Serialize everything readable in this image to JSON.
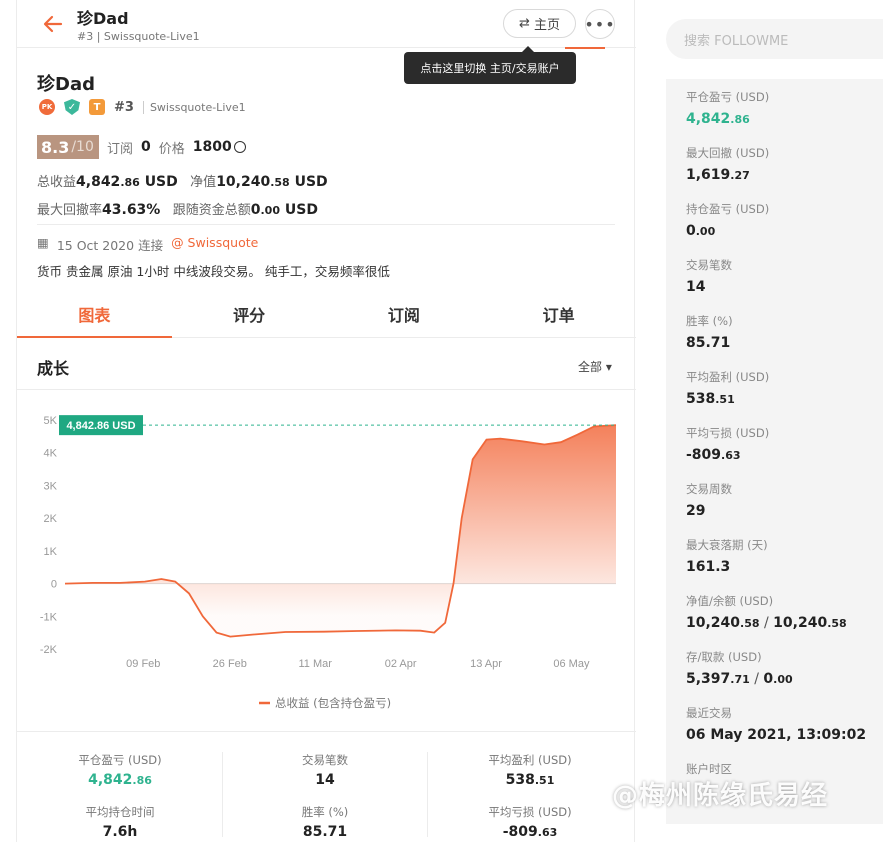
{
  "header": {
    "name": "珍Dad",
    "rank": "#3",
    "broker": "Swissquote-Live1",
    "home_label": "主页",
    "more_label": "•••",
    "tooltip": "点击这里切换 主页/交易账户"
  },
  "profile": {
    "name": "珍Dad",
    "badge_pk": "PK",
    "badge_t": "T",
    "rank": "#3",
    "broker": "Swissquote-Live1",
    "score": "8.3",
    "score_max": "/10",
    "subs_label": "订阅",
    "subs_value": "0",
    "price_label": "价格",
    "price_value": "1800",
    "total_label": "总收益",
    "total_int": "4,842",
    "total_dec": ".86",
    "total_unit": "USD",
    "equity_label": "净值",
    "equity_int": "10,240",
    "equity_dec": ".58",
    "equity_unit": "USD",
    "dd_label": "最大回撤率",
    "dd_value": "43.63%",
    "follow_label": "跟随资金总额",
    "follow_int": "0",
    "follow_dec": ".00",
    "follow_unit": "USD",
    "date": "15 Oct 2020 连接",
    "ext": "@ Swissquote",
    "description": "货币 贵金属 原油 1小时 中线波段交易。 纯手工，交易频率很低"
  },
  "tabs": [
    "图表",
    "评分",
    "订阅",
    "订单"
  ],
  "growth": {
    "title": "成长",
    "filter": "全部 ▾"
  },
  "chart_data": {
    "type": "area",
    "title": "",
    "legend": "总收益 (包含持仓盈亏)",
    "yticks": [
      "5K",
      "4K",
      "3K",
      "2K",
      "1K",
      "0",
      "-1K",
      "-2K"
    ],
    "ylim": [
      -2000,
      5000
    ],
    "xticks": [
      "09 Feb",
      "26 Feb",
      "11 Mar",
      "02 Apr",
      "13 Apr",
      "06 May"
    ],
    "current_label": "4,842.86 USD",
    "current_value": 4842.86,
    "series": [
      {
        "name": "总收益 (包含持仓盈亏)",
        "points": [
          [
            0,
            0
          ],
          [
            0.05,
            20
          ],
          [
            0.1,
            20
          ],
          [
            0.145,
            60
          ],
          [
            0.175,
            140
          ],
          [
            0.2,
            60
          ],
          [
            0.225,
            -300
          ],
          [
            0.25,
            -1000
          ],
          [
            0.275,
            -1500
          ],
          [
            0.3,
            -1620
          ],
          [
            0.34,
            -1560
          ],
          [
            0.4,
            -1480
          ],
          [
            0.47,
            -1470
          ],
          [
            0.53,
            -1450
          ],
          [
            0.6,
            -1430
          ],
          [
            0.645,
            -1440
          ],
          [
            0.67,
            -1500
          ],
          [
            0.69,
            -1200
          ],
          [
            0.705,
            0
          ],
          [
            0.72,
            2000
          ],
          [
            0.74,
            3800
          ],
          [
            0.765,
            4400
          ],
          [
            0.79,
            4430
          ],
          [
            0.83,
            4350
          ],
          [
            0.87,
            4250
          ],
          [
            0.9,
            4320
          ],
          [
            0.93,
            4550
          ],
          [
            0.96,
            4800
          ],
          [
            1.0,
            4842.86
          ]
        ]
      }
    ]
  },
  "stats": [
    {
      "label": "平仓盈亏 (USD)",
      "int": "4,842",
      "dec": ".86",
      "green": true
    },
    {
      "label": "交易笔数",
      "int": "14",
      "dec": ""
    },
    {
      "label": "平均盈利 (USD)",
      "int": "538",
      "dec": ".51"
    },
    {
      "label": "平均持仓时间",
      "int": "7.6h",
      "dec": ""
    },
    {
      "label": "胜率 (%)",
      "int": "85.71",
      "dec": ""
    },
    {
      "label": "平均亏损 (USD)",
      "int": "-809",
      "dec": ".63"
    }
  ],
  "side": {
    "search_placeholder": "搜索 FOLLOWME",
    "items": [
      {
        "label": "平仓盈亏 (USD)",
        "main": "4,842",
        "dec": ".86",
        "green": true
      },
      {
        "label": "最大回撤 (USD)",
        "main": "1,619",
        "dec": ".27"
      },
      {
        "label": "持仓盈亏 (USD)",
        "main": "0",
        "dec": ".00"
      },
      {
        "label": "交易笔数",
        "main": "14",
        "dec": ""
      },
      {
        "label": "胜率 (%)",
        "main": "85.71",
        "dec": ""
      },
      {
        "label": "平均盈利 (USD)",
        "main": "538",
        "dec": ".51"
      },
      {
        "label": "平均亏损 (USD)",
        "main": "-809",
        "dec": ".63"
      },
      {
        "label": "交易周数",
        "main": "29",
        "dec": ""
      },
      {
        "label": "最大衰落期 (天)",
        "main": "161.3",
        "dec": ""
      },
      {
        "label": "净值/余额 (USD)",
        "main": "10,240",
        "dec": ".58",
        "main2": "10,240",
        "dec2": ".58"
      },
      {
        "label": "存/取款 (USD)",
        "main": "5,397",
        "dec": ".71",
        "main2": "0",
        "dec2": ".00"
      },
      {
        "label": "最近交易",
        "main": "06 May 2021, 13:09:02",
        "dec": ""
      },
      {
        "label": "账户时区",
        "main": "",
        "dec": ""
      }
    ]
  },
  "watermark": "@梅州陈缘氏易经"
}
